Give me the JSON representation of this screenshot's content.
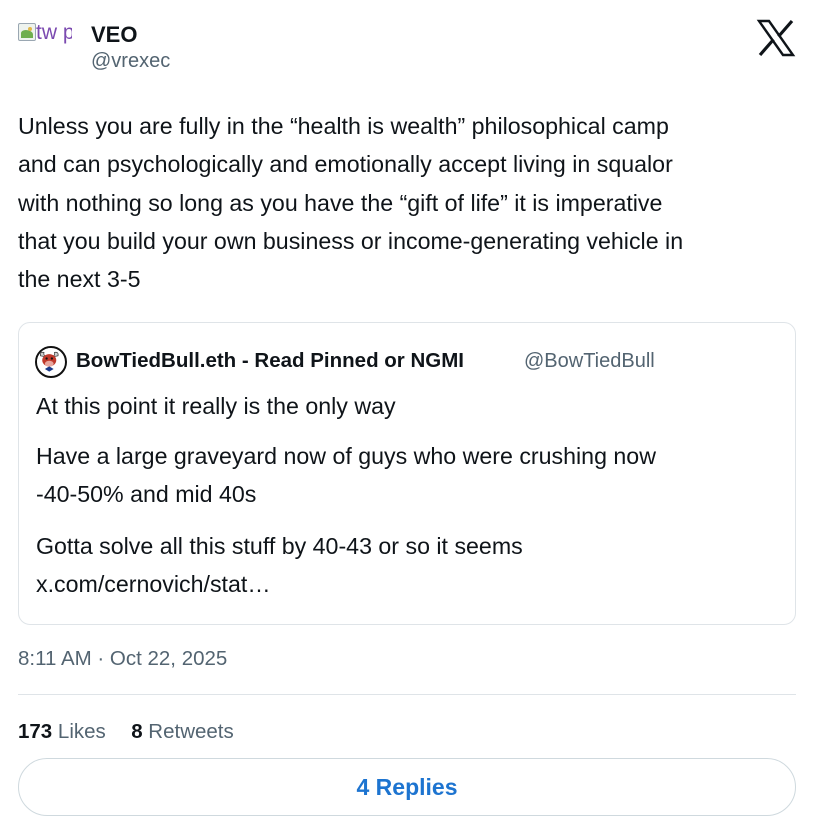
{
  "author": {
    "avatar_alt": "tw profil",
    "display_name": "VEO",
    "handle": "@vrexec"
  },
  "tweet": {
    "text_lines": [
      "Unless you are fully in the “health is wealth” philosophical camp",
      "and can psychologically and emotionally accept living in squalor",
      "with nothing so long as you have the “gift of life” it is imperative",
      "that you build your own business or income-generating vehicle in",
      "the next 3-5"
    ]
  },
  "quote": {
    "display_name": "BowTiedBull.eth - Read Pinned or NGMI",
    "handle": "@BowTiedBull",
    "lines": [
      "At this point it really is the only way",
      "Have a large graveyard now of guys who were crushing now",
      "-40-50% and mid 40s",
      "Gotta solve all this stuff by 40-43 or so it seems",
      "x.com/cernovich/stat…"
    ]
  },
  "meta": {
    "timestamp": "8:11 AM · Oct 22, 2025"
  },
  "stats": {
    "likes_count": "173",
    "likes_label": "Likes",
    "retweets_count": "8",
    "retweets_label": "Retweets"
  },
  "replies_button": "4 Replies",
  "icons": {
    "brand": "x-logo-icon",
    "avatar": "broken-image-icon",
    "quote_avatar": "bull-avatar-icon"
  },
  "colors": {
    "text": "#0f1419",
    "secondary": "#536471",
    "link": "#1d74d0",
    "border": "#dfe4e8"
  }
}
